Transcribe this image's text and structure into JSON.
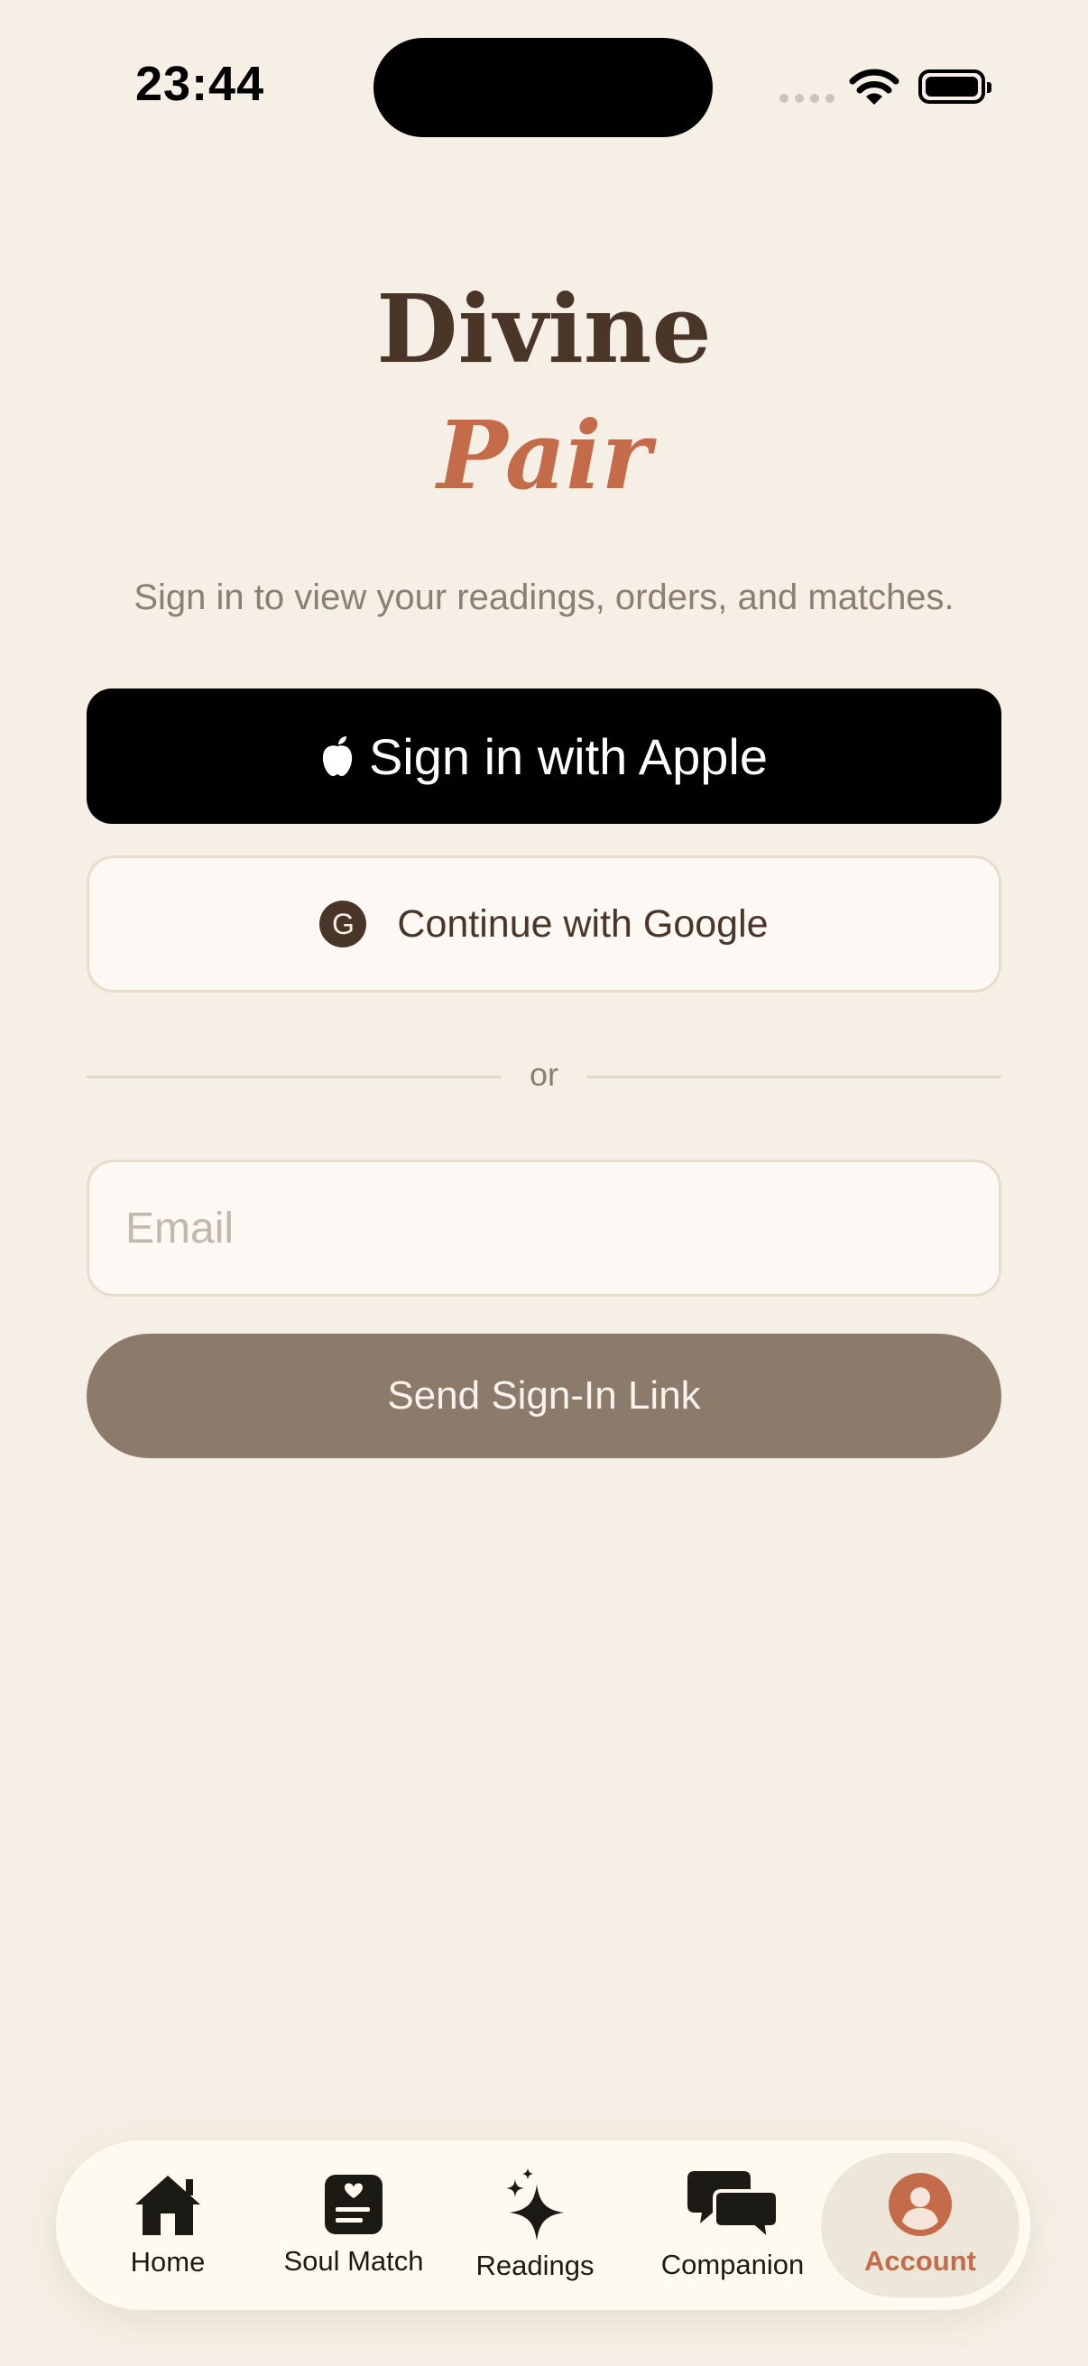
{
  "status_bar": {
    "time": "23:44"
  },
  "brand": {
    "title_line1": "Divine",
    "title_line2": "Pair"
  },
  "subtitle": "Sign in to view your readings, orders, and matches.",
  "buttons": {
    "apple": "Sign in with Apple",
    "google": "Continue with Google",
    "google_badge": "G",
    "send_link": "Send Sign-In Link"
  },
  "divider_text": "or",
  "email_field": {
    "placeholder": "Email",
    "value": ""
  },
  "tab_bar": {
    "active": "Account",
    "items": [
      {
        "label": "Home",
        "icon": "home-icon"
      },
      {
        "label": "Soul Match",
        "icon": "heart-card-icon"
      },
      {
        "label": "Readings",
        "icon": "sparkles-icon"
      },
      {
        "label": "Companion",
        "icon": "chat-bubbles-icon"
      },
      {
        "label": "Account",
        "icon": "person-circle-icon"
      }
    ]
  },
  "colors": {
    "background": "#F5EFE5",
    "brand_dark": "#4A3628",
    "accent": "#C46B49",
    "send_button": "#8C7A6B"
  }
}
